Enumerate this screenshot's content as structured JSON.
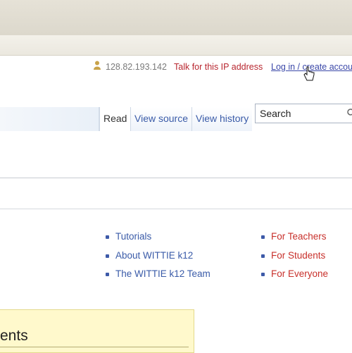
{
  "personal_bar": {
    "ip_address": "128.82.193.142",
    "talk_link": "Talk for this IP address",
    "login_link": "Log in / create accou"
  },
  "views": {
    "tabs": [
      {
        "label": "Read",
        "selected": true
      },
      {
        "label": "View source",
        "selected": false
      },
      {
        "label": "View history",
        "selected": false
      }
    ]
  },
  "search": {
    "placeholder": "Search"
  },
  "links": {
    "column1": [
      "Tutorials",
      "About WITTIE k12",
      "The WITTIE k12 Team"
    ],
    "column2": [
      "For Teachers",
      "For Students",
      "For Everyone"
    ]
  },
  "box": {
    "heading_fragment": "ents"
  },
  "colors": {
    "link_blue": "#3a5ba8",
    "link_red": "#c8302b",
    "highlight_yellow": "#fff9cc"
  }
}
